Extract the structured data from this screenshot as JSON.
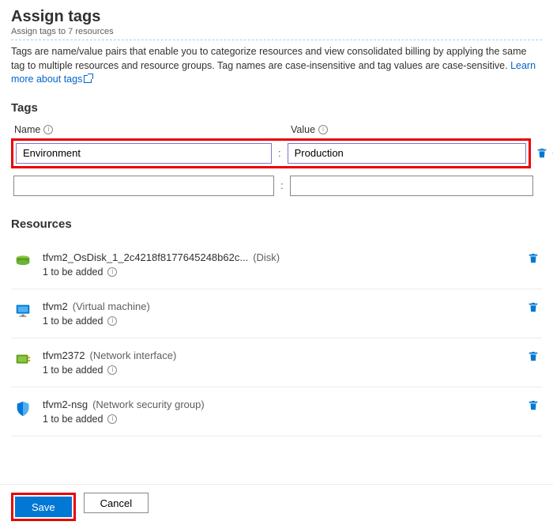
{
  "header": {
    "title": "Assign tags",
    "subtitle": "Assign tags to 7 resources"
  },
  "description": {
    "text": "Tags are name/value pairs that enable you to categorize resources and view consolidated billing by applying the same tag to multiple resources and resource groups. Tag names are case-insensitive and tag values are case-sensitive. ",
    "link_text": "Learn more about tags"
  },
  "tags_section": {
    "heading": "Tags",
    "name_label": "Name",
    "value_label": "Value",
    "rows": [
      {
        "name": "Environment",
        "value": "Production"
      },
      {
        "name": "",
        "value": ""
      }
    ]
  },
  "resources_section": {
    "heading": "Resources",
    "items": [
      {
        "name": "tfvm2_OsDisk_1_2c4218f8177645248b62c...",
        "type": "(Disk)",
        "sub": "1 to be added",
        "icon": "disk"
      },
      {
        "name": "tfvm2",
        "type": "(Virtual machine)",
        "sub": "1 to be added",
        "icon": "vm"
      },
      {
        "name": "tfvm2372",
        "type": "(Network interface)",
        "sub": "1 to be added",
        "icon": "nic"
      },
      {
        "name": "tfvm2-nsg",
        "type": "(Network security group)",
        "sub": "1 to be added",
        "icon": "nsg"
      }
    ]
  },
  "footer": {
    "save": "Save",
    "cancel": "Cancel"
  }
}
